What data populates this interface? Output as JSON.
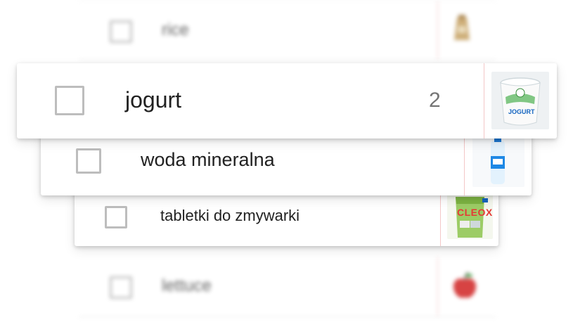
{
  "list": {
    "items": [
      {
        "label": "rice",
        "quantity": "",
        "icon": "rice-bag-icon"
      },
      {
        "label": "jogurt",
        "quantity": "2",
        "icon": "yogurt-cup-icon",
        "thumb_text": "JOGURT"
      },
      {
        "label": "woda mineralna",
        "quantity": "",
        "icon": "water-bottle-icon"
      },
      {
        "label": "tabletki do zmywarki",
        "quantity": "",
        "icon": "dishwasher-tablets-icon",
        "thumb_text": "CLEOX"
      },
      {
        "label": "lettuce",
        "quantity": "",
        "icon": "apple-icon"
      }
    ]
  },
  "colors": {
    "divider": "#f3c7c7",
    "checkbox_border": "#bdbdbd",
    "apple_red": "#d32f2f",
    "cleox_green": "#8bc34a"
  }
}
